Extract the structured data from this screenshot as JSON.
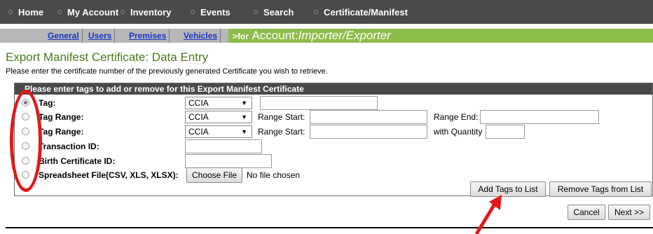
{
  "nav": {
    "items": [
      {
        "label": "Home"
      },
      {
        "label": "My Account"
      },
      {
        "label": "Inventory"
      },
      {
        "label": "Events"
      },
      {
        "label": "Search"
      },
      {
        "label": "Certificate/Manifest"
      }
    ]
  },
  "subnav": {
    "tabs": [
      "General",
      "Users",
      "Premises",
      "Vehicles"
    ],
    "for_prefix": ">for",
    "account_label": "Account:",
    "account_value": "Importer/Exporter"
  },
  "page": {
    "title": "Export Manifest Certificate: Data Entry",
    "instruction": "Please enter the certificate number of the previously generated Certificate you wish to retrieve."
  },
  "panel": {
    "header": "Please enter tags to add or remove for this Export Manifest Certificate",
    "rows": {
      "tag": {
        "label": "Tag:",
        "select": "CCIA"
      },
      "tag_range_1": {
        "label": "Tag Range:",
        "select": "CCIA",
        "range_start_label": "Range Start:",
        "range_end_label": "Range End:"
      },
      "tag_range_2": {
        "label": "Tag Range:",
        "select": "CCIA",
        "range_start_label": "Range Start:",
        "quantity_label": "with Quantity"
      },
      "transaction_id": {
        "label": "Transaction ID:"
      },
      "birth_certificate_id": {
        "label": "Birth Certificate ID:"
      },
      "spreadsheet": {
        "label": "Spreadsheet File(CSV, XLS, XLSX):",
        "choose_file": "Choose File",
        "file_status": "No file chosen"
      }
    },
    "add_tags_button": "Add Tags to List",
    "remove_tags_button": "Remove Tags from List"
  },
  "footer": {
    "cancel_button": "Cancel",
    "next_button": "Next >>"
  },
  "colors": {
    "nav_bg": "#4a4a4a",
    "accent_green": "#8ebc4a",
    "title_green": "#4a7a1a",
    "annotation_red": "#e01a1a"
  }
}
